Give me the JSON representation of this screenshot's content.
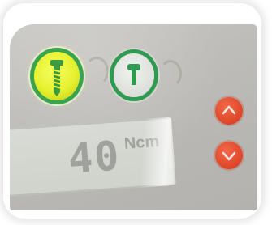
{
  "display": {
    "value": "40",
    "unit": "Ncm"
  },
  "buttons": {
    "left": {
      "icon": "screw-icon",
      "color": "#e6f02e",
      "ring": "#3aa44a"
    },
    "right": {
      "icon": "hex-screw-icon",
      "color": "#e0e2de",
      "ring": "#2f9a52"
    },
    "up": {
      "icon": "chevron-up-icon",
      "color": "#e24a2c"
    },
    "down": {
      "icon": "chevron-down-icon",
      "color": "#e24a2c"
    }
  }
}
